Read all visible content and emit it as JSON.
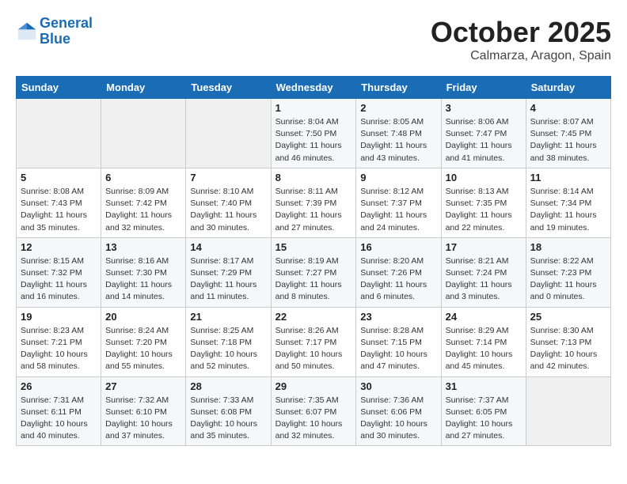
{
  "header": {
    "logo_line1": "General",
    "logo_line2": "Blue",
    "month": "October 2025",
    "location": "Calmarza, Aragon, Spain"
  },
  "weekdays": [
    "Sunday",
    "Monday",
    "Tuesday",
    "Wednesday",
    "Thursday",
    "Friday",
    "Saturday"
  ],
  "weeks": [
    [
      {
        "day": "",
        "info": ""
      },
      {
        "day": "",
        "info": ""
      },
      {
        "day": "",
        "info": ""
      },
      {
        "day": "1",
        "info": "Sunrise: 8:04 AM\nSunset: 7:50 PM\nDaylight: 11 hours and 46 minutes."
      },
      {
        "day": "2",
        "info": "Sunrise: 8:05 AM\nSunset: 7:48 PM\nDaylight: 11 hours and 43 minutes."
      },
      {
        "day": "3",
        "info": "Sunrise: 8:06 AM\nSunset: 7:47 PM\nDaylight: 11 hours and 41 minutes."
      },
      {
        "day": "4",
        "info": "Sunrise: 8:07 AM\nSunset: 7:45 PM\nDaylight: 11 hours and 38 minutes."
      }
    ],
    [
      {
        "day": "5",
        "info": "Sunrise: 8:08 AM\nSunset: 7:43 PM\nDaylight: 11 hours and 35 minutes."
      },
      {
        "day": "6",
        "info": "Sunrise: 8:09 AM\nSunset: 7:42 PM\nDaylight: 11 hours and 32 minutes."
      },
      {
        "day": "7",
        "info": "Sunrise: 8:10 AM\nSunset: 7:40 PM\nDaylight: 11 hours and 30 minutes."
      },
      {
        "day": "8",
        "info": "Sunrise: 8:11 AM\nSunset: 7:39 PM\nDaylight: 11 hours and 27 minutes."
      },
      {
        "day": "9",
        "info": "Sunrise: 8:12 AM\nSunset: 7:37 PM\nDaylight: 11 hours and 24 minutes."
      },
      {
        "day": "10",
        "info": "Sunrise: 8:13 AM\nSunset: 7:35 PM\nDaylight: 11 hours and 22 minutes."
      },
      {
        "day": "11",
        "info": "Sunrise: 8:14 AM\nSunset: 7:34 PM\nDaylight: 11 hours and 19 minutes."
      }
    ],
    [
      {
        "day": "12",
        "info": "Sunrise: 8:15 AM\nSunset: 7:32 PM\nDaylight: 11 hours and 16 minutes."
      },
      {
        "day": "13",
        "info": "Sunrise: 8:16 AM\nSunset: 7:30 PM\nDaylight: 11 hours and 14 minutes."
      },
      {
        "day": "14",
        "info": "Sunrise: 8:17 AM\nSunset: 7:29 PM\nDaylight: 11 hours and 11 minutes."
      },
      {
        "day": "15",
        "info": "Sunrise: 8:19 AM\nSunset: 7:27 PM\nDaylight: 11 hours and 8 minutes."
      },
      {
        "day": "16",
        "info": "Sunrise: 8:20 AM\nSunset: 7:26 PM\nDaylight: 11 hours and 6 minutes."
      },
      {
        "day": "17",
        "info": "Sunrise: 8:21 AM\nSunset: 7:24 PM\nDaylight: 11 hours and 3 minutes."
      },
      {
        "day": "18",
        "info": "Sunrise: 8:22 AM\nSunset: 7:23 PM\nDaylight: 11 hours and 0 minutes."
      }
    ],
    [
      {
        "day": "19",
        "info": "Sunrise: 8:23 AM\nSunset: 7:21 PM\nDaylight: 10 hours and 58 minutes."
      },
      {
        "day": "20",
        "info": "Sunrise: 8:24 AM\nSunset: 7:20 PM\nDaylight: 10 hours and 55 minutes."
      },
      {
        "day": "21",
        "info": "Sunrise: 8:25 AM\nSunset: 7:18 PM\nDaylight: 10 hours and 52 minutes."
      },
      {
        "day": "22",
        "info": "Sunrise: 8:26 AM\nSunset: 7:17 PM\nDaylight: 10 hours and 50 minutes."
      },
      {
        "day": "23",
        "info": "Sunrise: 8:28 AM\nSunset: 7:15 PM\nDaylight: 10 hours and 47 minutes."
      },
      {
        "day": "24",
        "info": "Sunrise: 8:29 AM\nSunset: 7:14 PM\nDaylight: 10 hours and 45 minutes."
      },
      {
        "day": "25",
        "info": "Sunrise: 8:30 AM\nSunset: 7:13 PM\nDaylight: 10 hours and 42 minutes."
      }
    ],
    [
      {
        "day": "26",
        "info": "Sunrise: 7:31 AM\nSunset: 6:11 PM\nDaylight: 10 hours and 40 minutes."
      },
      {
        "day": "27",
        "info": "Sunrise: 7:32 AM\nSunset: 6:10 PM\nDaylight: 10 hours and 37 minutes."
      },
      {
        "day": "28",
        "info": "Sunrise: 7:33 AM\nSunset: 6:08 PM\nDaylight: 10 hours and 35 minutes."
      },
      {
        "day": "29",
        "info": "Sunrise: 7:35 AM\nSunset: 6:07 PM\nDaylight: 10 hours and 32 minutes."
      },
      {
        "day": "30",
        "info": "Sunrise: 7:36 AM\nSunset: 6:06 PM\nDaylight: 10 hours and 30 minutes."
      },
      {
        "day": "31",
        "info": "Sunrise: 7:37 AM\nSunset: 6:05 PM\nDaylight: 10 hours and 27 minutes."
      },
      {
        "day": "",
        "info": ""
      }
    ]
  ]
}
